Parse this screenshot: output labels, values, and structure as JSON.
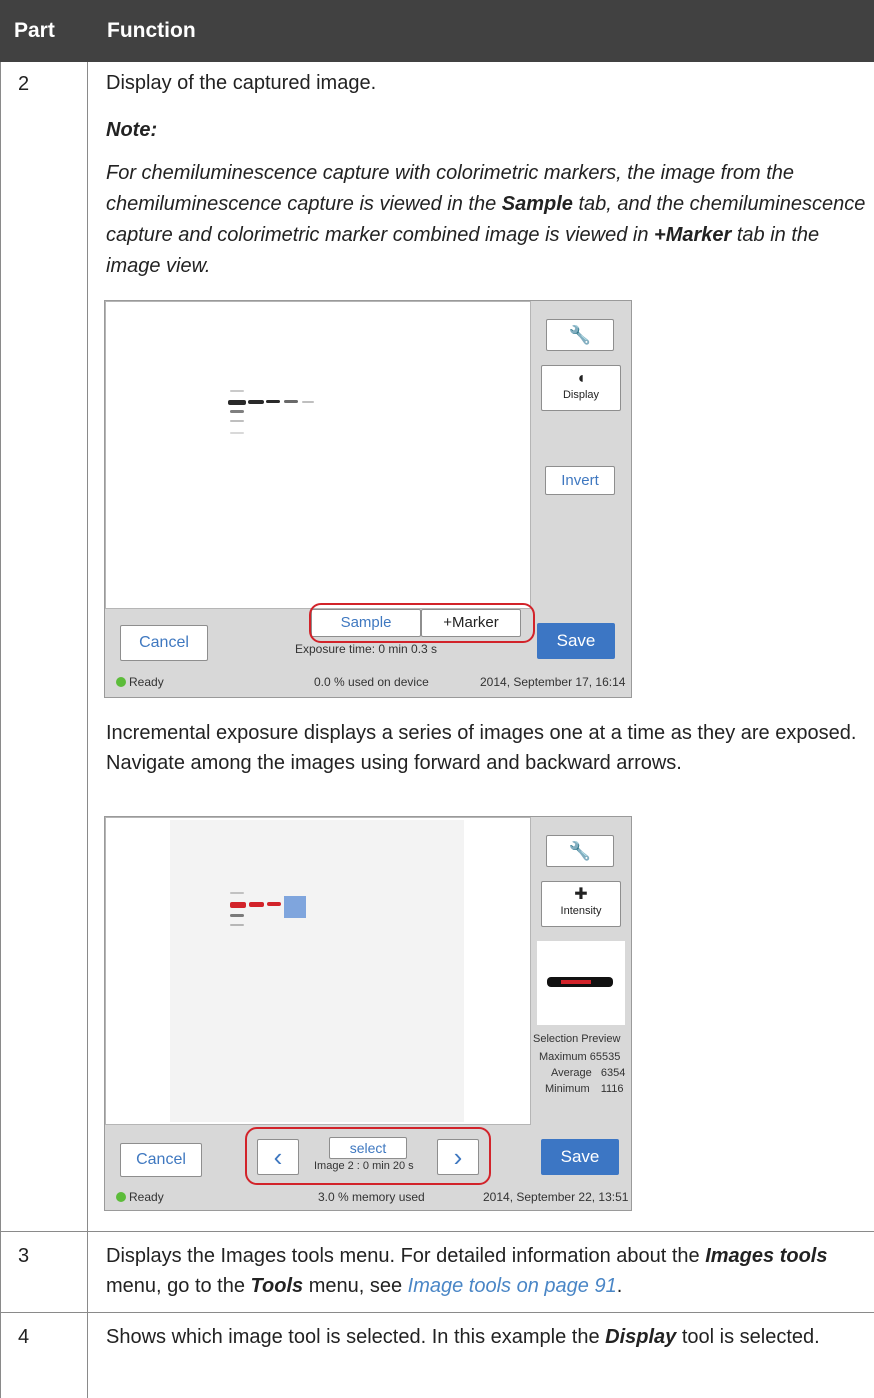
{
  "table": {
    "header": {
      "part": "Part",
      "function": "Function"
    },
    "rows": [
      {
        "part": "2",
        "function": "Display of the captured image.",
        "note_label": "Note:",
        "note": {
          "t1": "For chemiluminescence capture with colorimetric markers, the image from the chemiluminescence capture is viewed in the ",
          "b1": "Sample",
          "t2": " tab, and the chemiluminescence capture and colorimetric marker combined image is viewed in ",
          "b2": "+Marker",
          "t3": " tab in the image view."
        },
        "incremental_text": "Incremental exposure displays a series of images one at a time as they are exposed. Navigate among the images using forward and backward arrows."
      },
      {
        "part": "3",
        "t1": "Displays the Images tools menu. For detailed information about the ",
        "b1": "Images tools",
        "t2": " menu, go to the ",
        "b2": "Tools",
        "t3": " menu, see ",
        "link": "Image tools on page 91",
        "t4": "."
      },
      {
        "part": "4",
        "t1": "Shows which image tool is selected. In this example the ",
        "b1": "Display",
        "t2": " tool is selected."
      }
    ]
  },
  "screen1": {
    "tool_icon": "wrench-icon",
    "display_icon": "display-icon",
    "display_label": "Display",
    "invert_label": "Invert",
    "tab_sample": "Sample",
    "tab_marker": "+Marker",
    "cancel_label": "Cancel",
    "save_label": "Save",
    "exposure": "Exposure time: 0 min 0.3 s",
    "status": "Ready",
    "memory": "0.0 % used on device",
    "datetime": "2014, September 17, 16:14"
  },
  "screen2": {
    "tool_icon": "wrench-icon",
    "intensity_icon": "pipette-icon",
    "intensity_label": "Intensity",
    "preview_label": "Selection Preview",
    "stats": [
      {
        "label": "Maximum",
        "value": "65535"
      },
      {
        "label": "Average",
        "value": "6354"
      },
      {
        "label": "Minimum",
        "value": "1116"
      }
    ],
    "prev_glyph": "‹",
    "next_glyph": "›",
    "select_label": "select",
    "image_info": "Image 2 : 0 min 20 s",
    "cancel_label": "Cancel",
    "save_label": "Save",
    "status": "Ready",
    "memory": "3.0 % memory used",
    "datetime": "2014, September 22, 13:51"
  },
  "colors": {
    "header_bg": "#414141",
    "accent": "#3c76c4",
    "highlight": "#d2232a",
    "link": "#4a86c6"
  }
}
